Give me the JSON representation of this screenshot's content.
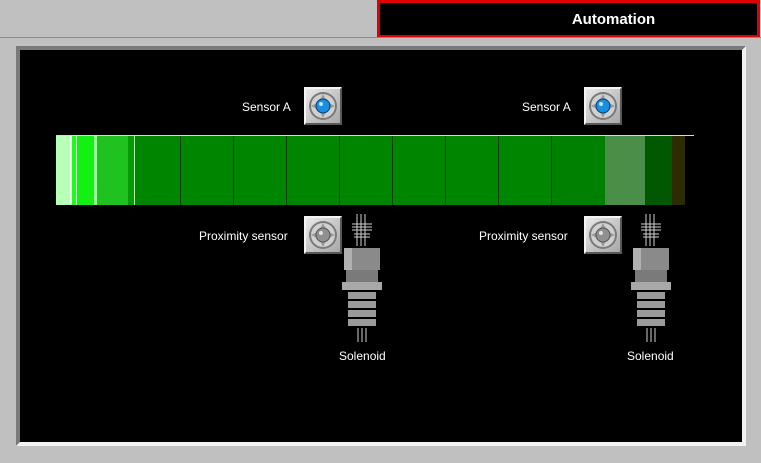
{
  "header": {
    "title": "Automation"
  },
  "colors": {
    "title_border": "#e00000",
    "panel_bg": "#000000",
    "conveyor_green": "#008000"
  },
  "conveyor": {
    "segments": [
      {
        "width": 14,
        "color": "#b8ffb8"
      },
      {
        "width": 2,
        "color": "#f0fff0"
      },
      {
        "width": 4,
        "color": "#19ff19"
      },
      {
        "width": 1,
        "color": "#c8ffc8"
      },
      {
        "width": 17,
        "color": "#14f014"
      },
      {
        "width": 3,
        "color": "#9cff9c"
      },
      {
        "width": 31,
        "color": "#1fc21f"
      },
      {
        "width": 6,
        "color": "#069a06"
      },
      {
        "width": 1,
        "color": "#b0ffb0"
      },
      {
        "width": 46,
        "color": "#008500",
        "divided": true
      },
      {
        "width": 53,
        "color": "#008500",
        "divided": true
      },
      {
        "width": 53,
        "color": "#008500",
        "divided": true
      },
      {
        "width": 53,
        "color": "#008500",
        "divided": true
      },
      {
        "width": 53,
        "color": "#008500",
        "divided": true
      },
      {
        "width": 53,
        "color": "#008500",
        "divided": true
      },
      {
        "width": 53,
        "color": "#008500",
        "divided": true
      },
      {
        "width": 53,
        "color": "#008500",
        "divided": true
      },
      {
        "width": 53,
        "color": "#008000"
      },
      {
        "width": 40,
        "color": "#4a8e4a"
      },
      {
        "width": 27,
        "color": "#005800"
      },
      {
        "width": 13,
        "color": "#2c2c00"
      }
    ]
  },
  "stations": [
    {
      "sensor_label": "Sensor A",
      "sensor_state": "on",
      "sensor_led_color": "#1a8fe0",
      "proximity_label": "Proximity sensor",
      "proximity_state": "off",
      "proximity_led_color": "#909090",
      "solenoid_label": "Solenoid"
    },
    {
      "sensor_label": "Sensor A",
      "sensor_state": "on",
      "sensor_led_color": "#1a8fe0",
      "proximity_label": "Proximity sensor",
      "proximity_state": "off",
      "proximity_led_color": "#909090",
      "solenoid_label": "Solenoid"
    }
  ]
}
